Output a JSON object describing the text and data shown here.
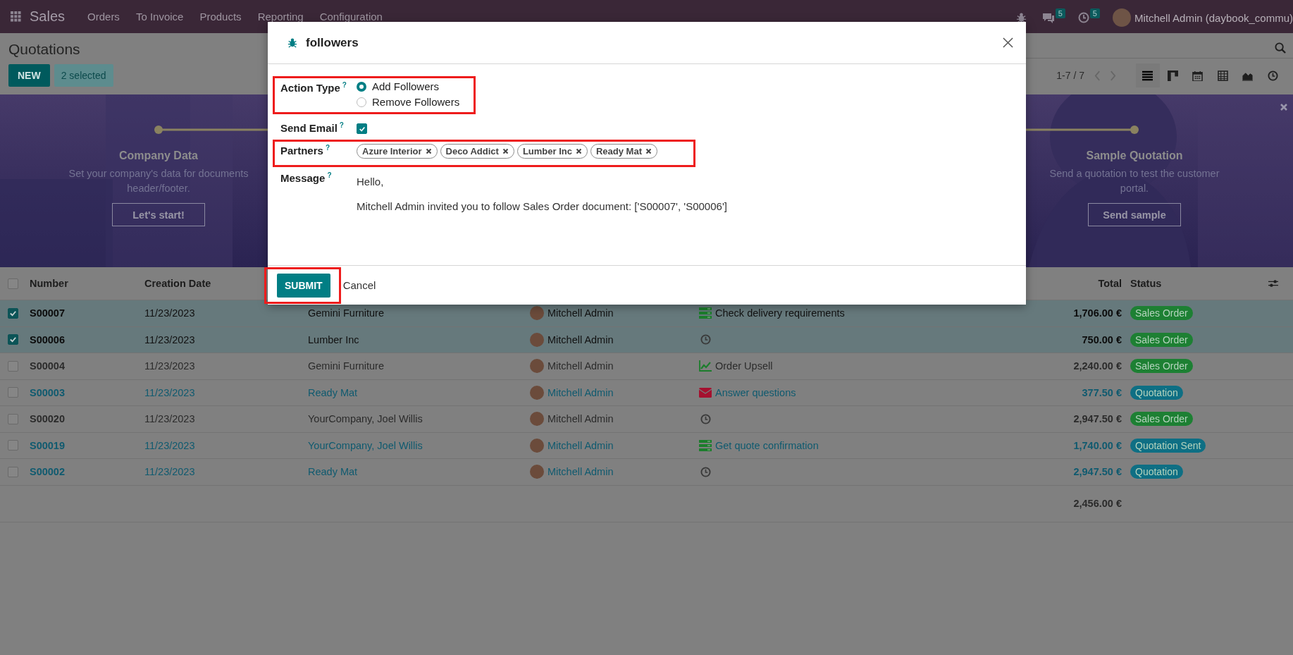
{
  "navbar": {
    "app": "Sales",
    "menu": [
      "Orders",
      "To Invoice",
      "Products",
      "Reporting",
      "Configuration"
    ],
    "messages_count": "5",
    "activities_count": "5",
    "user": "Mitchell Admin (daybook_commu)"
  },
  "control_panel": {
    "title": "Quotations",
    "new_button": "NEW",
    "selection": "2 selected",
    "pager": "1-7 / 7",
    "views": [
      {
        "kind": "list",
        "selected": true
      },
      {
        "kind": "kanban",
        "selected": false
      },
      {
        "kind": "calendar",
        "selected": false
      },
      {
        "kind": "pivot",
        "selected": false
      },
      {
        "kind": "graph",
        "selected": false
      },
      {
        "kind": "activity",
        "selected": false
      }
    ]
  },
  "banner": {
    "steps": [
      {
        "title": "Company Data",
        "text": "Set your company's data for documents header/footer.",
        "button": "Let's start!"
      },
      {
        "title": "Sample Quotation",
        "text": "Send a quotation to test the customer portal.",
        "button": "Send sample"
      }
    ]
  },
  "table": {
    "all_checked": false,
    "columns": [
      "Number",
      "Creation Date",
      "Total",
      "Status"
    ],
    "rows": [
      {
        "selected": true,
        "highlighted": false,
        "number": "S00007",
        "date": "11/23/2023",
        "customer": "Gemini Furniture",
        "salesperson": "Mitchell Admin",
        "activity": {
          "kind": "todo",
          "text": "Check delivery requirements"
        },
        "total": "1,706.00 €",
        "status": {
          "text": "Sales Order",
          "color": "#1d8033"
        }
      },
      {
        "selected": true,
        "highlighted": false,
        "number": "S00006",
        "date": "11/23/2023",
        "customer": "Lumber Inc",
        "salesperson": "Mitchell Admin",
        "activity": {
          "kind": "none"
        },
        "total": "750.00 €",
        "status": {
          "text": "Sales Order",
          "color": "#1d8033"
        }
      },
      {
        "selected": false,
        "highlighted": false,
        "number": "S00004",
        "date": "11/23/2023",
        "customer": "Gemini Furniture",
        "salesperson": "Mitchell Admin",
        "activity": {
          "kind": "upsell",
          "text": "Order Upsell"
        },
        "total": "2,240.00 €",
        "status": {
          "text": "Sales Order",
          "color": "#1d8033"
        }
      },
      {
        "selected": false,
        "highlighted": true,
        "number": "S00003",
        "date": "11/23/2023",
        "customer": "Ready Mat",
        "salesperson": "Mitchell Admin",
        "activity": {
          "kind": "email",
          "text": "Answer questions"
        },
        "total": "377.50 €",
        "status": {
          "text": "Quotation",
          "color": "#0e6f84"
        }
      },
      {
        "selected": false,
        "highlighted": false,
        "number": "S00020",
        "date": "11/23/2023",
        "customer": "YourCompany, Joel Willis",
        "salesperson": "Mitchell Admin",
        "activity": {
          "kind": "none"
        },
        "total": "2,947.50 €",
        "status": {
          "text": "Sales Order",
          "color": "#1d8033"
        }
      },
      {
        "selected": false,
        "highlighted": true,
        "number": "S00019",
        "date": "11/23/2023",
        "customer": "YourCompany, Joel Willis",
        "salesperson": "Mitchell Admin",
        "activity": {
          "kind": "todo",
          "text": "Get quote confirmation"
        },
        "total": "1,740.00 €",
        "status": {
          "text": "Quotation Sent",
          "color": "#0e6f84"
        }
      },
      {
        "selected": false,
        "highlighted": true,
        "number": "S00002",
        "date": "11/23/2023",
        "customer": "Ready Mat",
        "salesperson": "Mitchell Admin",
        "activity": {
          "kind": "none"
        },
        "total": "2,947.50 €",
        "status": {
          "text": "Quotation",
          "color": "#0e6f84"
        }
      }
    ],
    "sum_total": "2,456.00 €"
  },
  "dialog": {
    "title": "followers",
    "fields": [
      {
        "kind": "radio",
        "label": "Action Type",
        "help": "?",
        "highlighted": true,
        "options": [
          {
            "label": "Add Followers",
            "selected": true
          },
          {
            "label": "Remove Followers",
            "selected": false
          }
        ]
      },
      {
        "kind": "checkbox",
        "label": "Send Email",
        "help": "?",
        "highlighted": false,
        "checked": true
      },
      {
        "kind": "tags",
        "label": "Partners",
        "help": "?",
        "highlighted": true,
        "tags": [
          "Azure Interior",
          "Deco Addict",
          "Lumber Inc",
          "Ready Mat"
        ]
      },
      {
        "kind": "message",
        "label": "Message",
        "help": "?",
        "highlighted": false,
        "lines": [
          "Hello,",
          "Mitchell Admin invited you to follow Sales Order document: ['S00007', 'S00006']"
        ]
      }
    ],
    "buttons": [
      {
        "kind": "primary",
        "label": "SUBMIT",
        "highlighted": true
      },
      {
        "kind": "link",
        "label": "Cancel",
        "highlighted": false
      }
    ]
  }
}
